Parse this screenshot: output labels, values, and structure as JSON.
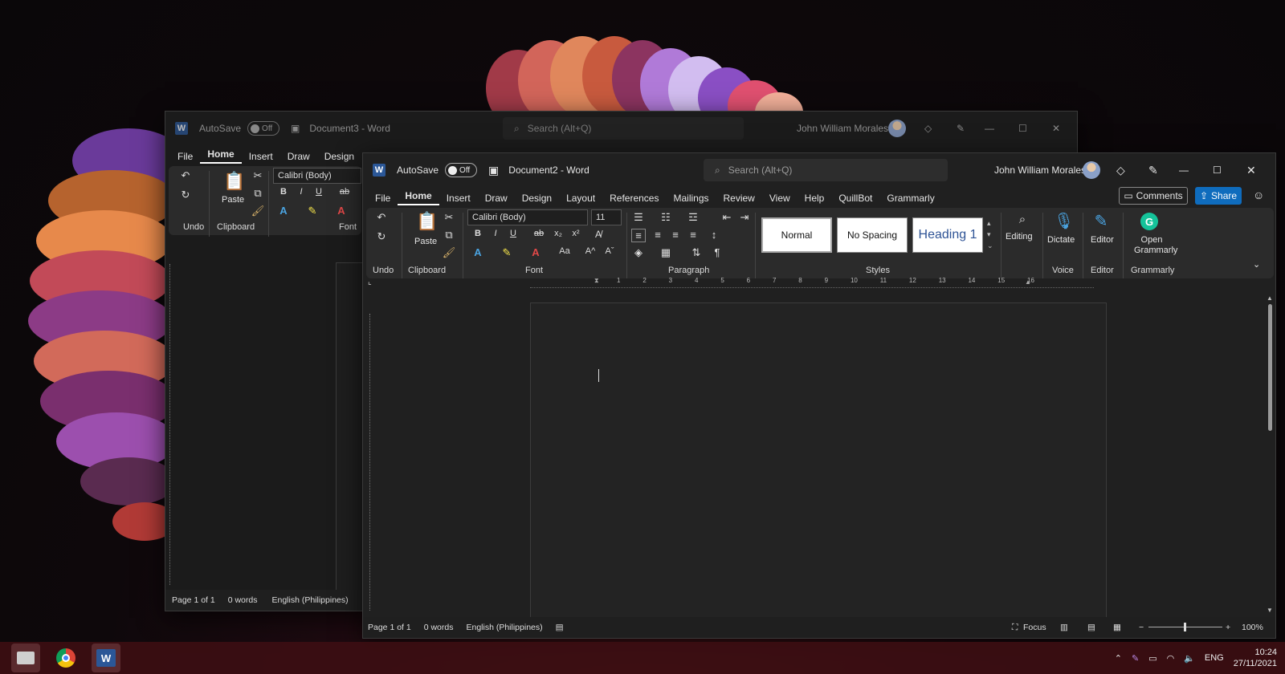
{
  "back_window": {
    "autosave_label": "AutoSave",
    "autosave_state": "Off",
    "doc_title": "Document3  -  Word",
    "search_placeholder": "Search (Alt+Q)",
    "user_name": "John William Morales",
    "menu": [
      "File",
      "Home",
      "Insert",
      "Draw",
      "Design"
    ],
    "font_name": "Calibri (Body)",
    "paste_label": "Paste",
    "groups": {
      "undo": "Undo",
      "clipboard": "Clipboard",
      "font": "Font"
    },
    "status": {
      "page": "Page 1 of 1",
      "words": "0 words",
      "language": "English (Philippines)"
    }
  },
  "front_window": {
    "autosave_label": "AutoSave",
    "autosave_state": "Off",
    "doc_title": "Document2  -  Word",
    "search_placeholder": "Search (Alt+Q)",
    "user_name": "John William Morales",
    "menu": [
      "File",
      "Home",
      "Insert",
      "Draw",
      "Design",
      "Layout",
      "References",
      "Mailings",
      "Review",
      "View",
      "Help",
      "QuillBot",
      "Grammarly"
    ],
    "comments_label": "Comments",
    "share_label": "Share",
    "font_name": "Calibri (Body)",
    "font_size": "11",
    "paste_label": "Paste",
    "styles": [
      "Normal",
      "No Spacing",
      "Heading 1"
    ],
    "editing_label": "Editing",
    "dictate_label": "Dictate",
    "editor_label": "Editor",
    "grammarly_label": "Open Grammarly",
    "groups": {
      "undo": "Undo",
      "clipboard": "Clipboard",
      "font": "Font",
      "paragraph": "Paragraph",
      "styles": "Styles",
      "voice": "Voice",
      "editor": "Editor",
      "grammarly": "Grammarly"
    },
    "ruler_marks": [
      "1",
      "2",
      "3",
      "4",
      "5",
      "6",
      "7",
      "8",
      "9",
      "10",
      "11",
      "12",
      "13",
      "14",
      "15",
      "16"
    ],
    "status": {
      "page": "Page 1 of 1",
      "words": "0 words",
      "language": "English (Philippines)",
      "focus": "Focus",
      "zoom": "100%"
    }
  },
  "taskbar": {
    "language": "ENG",
    "time": "10:24",
    "date": "27/11/2021"
  },
  "colors": {
    "accent": "#0f6cbd",
    "word": "#2b5797",
    "grammarly": "#15c39a"
  }
}
